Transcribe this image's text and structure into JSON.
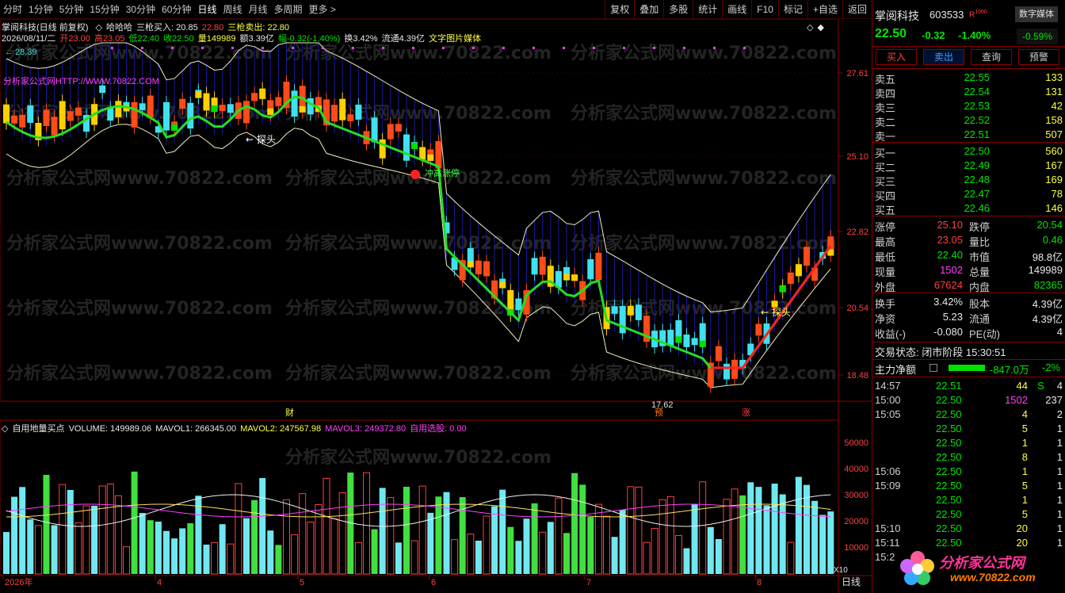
{
  "toolbar": {
    "periods": [
      "分时",
      "1分钟",
      "5分钟",
      "15分钟",
      "30分钟",
      "60分钟",
      "日线",
      "周线",
      "月线",
      "多周期",
      "更多 >"
    ],
    "active_period": "日线",
    "right_buttons": [
      "复权",
      "叠加",
      "多股",
      "统计",
      "画线",
      "F10",
      "标记",
      "+自选",
      "返回"
    ]
  },
  "chart": {
    "title": "掌阅科技(日线 前复权)",
    "indicator_name": "哈哈哈",
    "buy_label": "三枪买入: 20.85",
    "buy_extra": "22.80",
    "sell_label": "三枪卖出: 22.80",
    "ohlc": {
      "date": "2026/08/11/二",
      "open": "开23.00",
      "high": "高23.05",
      "low": "低22.40",
      "close": "收22.50",
      "volume": "量149989",
      "amount": "额3.39亿",
      "change": "幅-0.32(-1.40%)",
      "turnover": "换3.42%",
      "float": "流通4.39亿",
      "extra": "文字图片媒体"
    },
    "watermark": "分析家公式网www.70822.com",
    "url_text": "分析家公式网HTTP://WWW.70822.COM",
    "high_marker": "28.39",
    "low_marker": "17.62",
    "price_axis": [
      "27.61",
      "25.10",
      "22.82",
      "20.54",
      "18.48"
    ],
    "annotations": [
      "探头",
      "探头",
      "探头",
      "冲高涨停",
      "财",
      "预",
      "涨"
    ],
    "x_axis": [
      "2026年",
      "4",
      "5",
      "6",
      "7",
      "8"
    ],
    "bottom_right": "日线",
    "scale_label": "X10"
  },
  "volume_panel": {
    "title": "自用地量买点",
    "volume": "VOLUME: 149989.06",
    "mavol1": "MAVOL1: 266345.00",
    "mavol2": "MAVOL2: 247567.98",
    "mavol3": "MAVOL3: 249372.80",
    "select": "自用选股: 0.00",
    "axis": [
      "50000",
      "40000",
      "30000",
      "20000",
      "10000"
    ]
  },
  "quote": {
    "name": "掌阅科技",
    "code": "603533",
    "tag": "R",
    "media_button": "数字媒体",
    "price": "22.50",
    "change": "-0.32",
    "pct": "-1.40%",
    "sector_pct": "-0.59%",
    "buttons": [
      "买入",
      "卖出",
      "查询",
      "预警"
    ],
    "asks": [
      {
        "label": "卖五",
        "price": "22.55",
        "vol": "133"
      },
      {
        "label": "卖四",
        "price": "22.54",
        "vol": "131"
      },
      {
        "label": "卖三",
        "price": "22.53",
        "vol": "42"
      },
      {
        "label": "卖二",
        "price": "22.52",
        "vol": "158"
      },
      {
        "label": "卖一",
        "price": "22.51",
        "vol": "507"
      }
    ],
    "bids": [
      {
        "label": "买一",
        "price": "22.50",
        "vol": "560"
      },
      {
        "label": "买二",
        "price": "22.49",
        "vol": "167"
      },
      {
        "label": "买三",
        "price": "22.48",
        "vol": "169"
      },
      {
        "label": "买四",
        "price": "22.47",
        "vol": "78"
      },
      {
        "label": "买五",
        "price": "22.46",
        "vol": "146"
      }
    ],
    "stats": [
      {
        "l1": "涨停",
        "v1": "25.10",
        "c1": "red",
        "l2": "跌停",
        "v2": "20.54",
        "c2": "green"
      },
      {
        "l1": "最高",
        "v1": "23.05",
        "c1": "red",
        "l2": "量比",
        "v2": "0.46",
        "c2": "green"
      },
      {
        "l1": "最低",
        "v1": "22.40",
        "c1": "green",
        "l2": "市值",
        "v2": "98.8亿",
        "c2": "white"
      },
      {
        "l1": "现量",
        "v1": "1502",
        "c1": "mag",
        "l2": "总量",
        "v2": "149989",
        "c2": "white"
      },
      {
        "l1": "外盘",
        "v1": "67624",
        "c1": "red",
        "l2": "内盘",
        "v2": "82365",
        "c2": "green"
      }
    ],
    "stats2": [
      {
        "l1": "换手",
        "v1": "3.42%",
        "l2": "股本",
        "v2": "4.39亿"
      },
      {
        "l1": "净资",
        "v1": "5.23",
        "l2": "流通",
        "v2": "4.39亿"
      },
      {
        "l1": "收益(-)",
        "v1": "-0.080",
        "l2": "PE(动)",
        "v2": "4"
      }
    ],
    "trade_status": "交易状态: 闭市阶段 15:30:51",
    "main_flow_label": "主力净额",
    "main_flow_value": "-847.0万",
    "main_flow_pct": "-2%",
    "ticks": [
      {
        "t": "14:57",
        "p": "22.51",
        "v": "44",
        "vc": "yellow",
        "f": "S",
        "fv": "4"
      },
      {
        "t": "15:00",
        "p": "22.50",
        "v": "1502",
        "vc": "mag",
        "f": "",
        "fv": "237"
      },
      {
        "t": "15:05",
        "p": "22.50",
        "v": "4",
        "vc": "yellow",
        "f": "",
        "fv": "2"
      },
      {
        "t": "",
        "p": "22.50",
        "v": "5",
        "vc": "yellow",
        "f": "",
        "fv": "1"
      },
      {
        "t": "",
        "p": "22.50",
        "v": "1",
        "vc": "yellow",
        "f": "",
        "fv": "1"
      },
      {
        "t": "",
        "p": "22.50",
        "v": "8",
        "vc": "yellow",
        "f": "",
        "fv": "1"
      },
      {
        "t": "15:06",
        "p": "22.50",
        "v": "1",
        "vc": "yellow",
        "f": "",
        "fv": "1"
      },
      {
        "t": "15:09",
        "p": "22.50",
        "v": "5",
        "vc": "yellow",
        "f": "",
        "fv": "1"
      },
      {
        "t": "",
        "p": "22.50",
        "v": "1",
        "vc": "yellow",
        "f": "",
        "fv": "1"
      },
      {
        "t": "",
        "p": "22.50",
        "v": "5",
        "vc": "yellow",
        "f": "",
        "fv": "1"
      },
      {
        "t": "15:10",
        "p": "22.50",
        "v": "20",
        "vc": "yellow",
        "f": "",
        "fv": "1"
      },
      {
        "t": "15:11",
        "p": "22.50",
        "v": "20",
        "vc": "yellow",
        "f": "",
        "fv": "1"
      },
      {
        "t": "15:2",
        "p": "",
        "v": "",
        "vc": "yellow",
        "f": "",
        "fv": ""
      }
    ],
    "logo_text": "分析家公式网",
    "logo_url": "www.70822.com"
  }
}
